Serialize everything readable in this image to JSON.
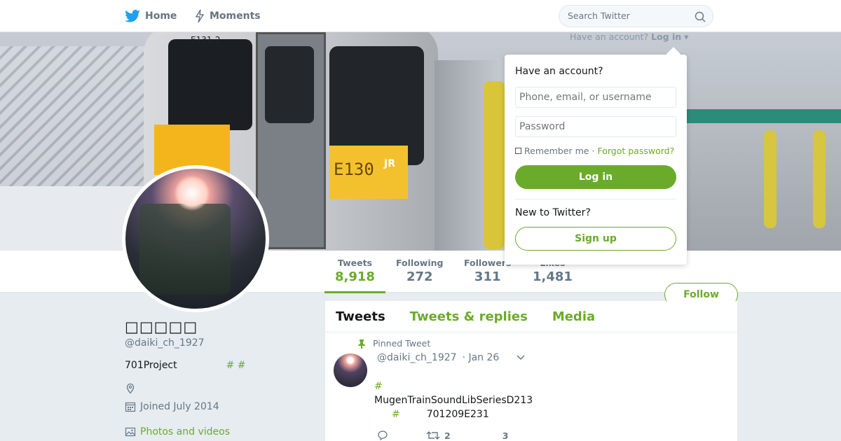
{
  "nav": {
    "home_label": "Home",
    "moments_label": "Moments",
    "search_placeholder": "Search Twitter",
    "have_account_prefix": "Have an account?",
    "login_link": "Log in",
    "accent_color": "#6bab2b"
  },
  "banner": {
    "train_number_text": "E131-2",
    "plate_text": "E130",
    "jr_text": "JR"
  },
  "stats": [
    {
      "label": "Tweets",
      "value": "8,918"
    },
    {
      "label": "Following",
      "value": "272"
    },
    {
      "label": "Followers",
      "value": "311"
    },
    {
      "label": "Likes",
      "value": "1,481"
    }
  ],
  "follow_label": "Follow",
  "profile": {
    "name": "□□□□□",
    "handle": "@daiki_ch_1927",
    "bio_text": "701Project",
    "bio_tags": "# #",
    "joined": "Joined July 2014",
    "photos_link": "Photos and videos"
  },
  "timeline": {
    "tabs": [
      "Tweets",
      "Tweets & replies",
      "Media"
    ],
    "tweet": {
      "pinned_label": "Pinned Tweet",
      "handle": "@daiki_ch_1927",
      "date": "· Jan 26",
      "line1_hash": "#",
      "line2": "MugenTrainSoundLibSeriesD213",
      "line3_hash": "#",
      "line3_text": "701209E231",
      "retweets": "2",
      "likes": "3"
    }
  },
  "login_dropdown": {
    "title": "Have an account?",
    "username_placeholder": "Phone, email, or username",
    "password_placeholder": "Password",
    "remember_label": "Remember me",
    "separator": "·",
    "forgot_label": "Forgot password?",
    "login_button": "Log in",
    "new_label": "New to Twitter?",
    "signup_button": "Sign up"
  }
}
